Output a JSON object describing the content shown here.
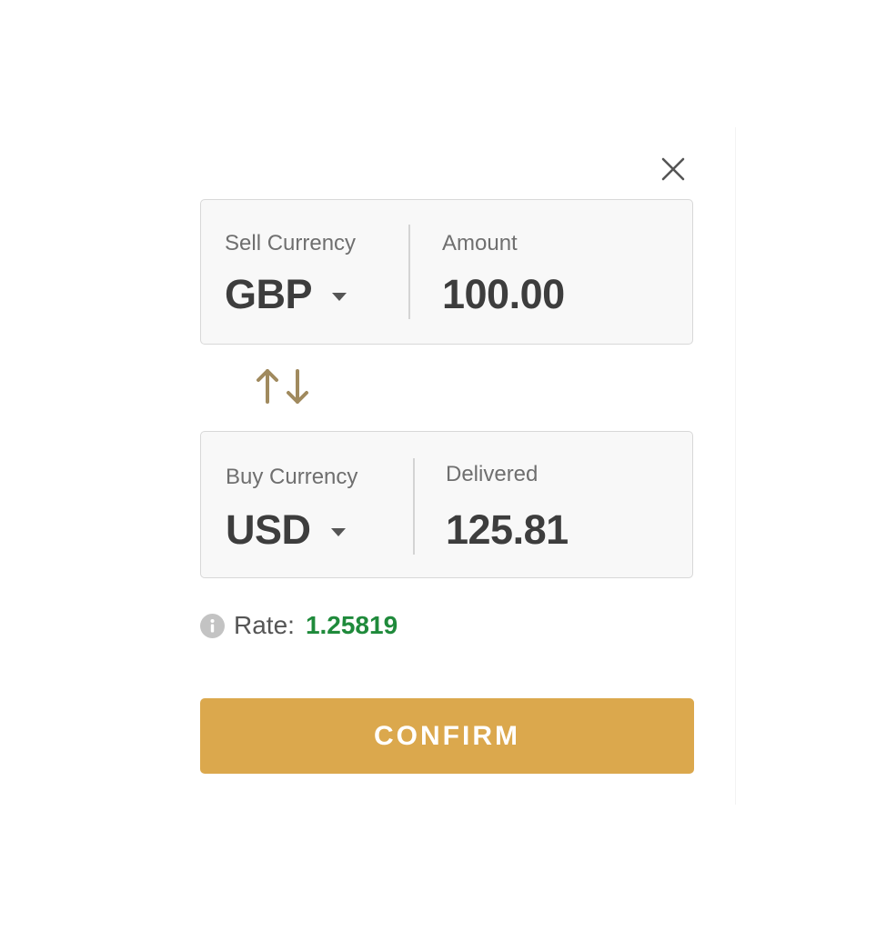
{
  "dialog": {
    "close_icon": "close-icon"
  },
  "sell": {
    "label": "Sell Currency",
    "currency": "GBP",
    "amount_label": "Amount",
    "amount_value": "100.00"
  },
  "swap": {
    "icon": "swap-arrows-icon",
    "color": "#a08a5e"
  },
  "buy": {
    "label": "Buy Currency",
    "currency": "USD",
    "delivered_label": "Delivered",
    "delivered_value": "125.81"
  },
  "rate": {
    "icon": "info-icon",
    "label": "Rate:",
    "value": "1.25819",
    "value_color": "#1f8a3b"
  },
  "confirm": {
    "label": "CONFIRM",
    "color": "#dba84d"
  }
}
